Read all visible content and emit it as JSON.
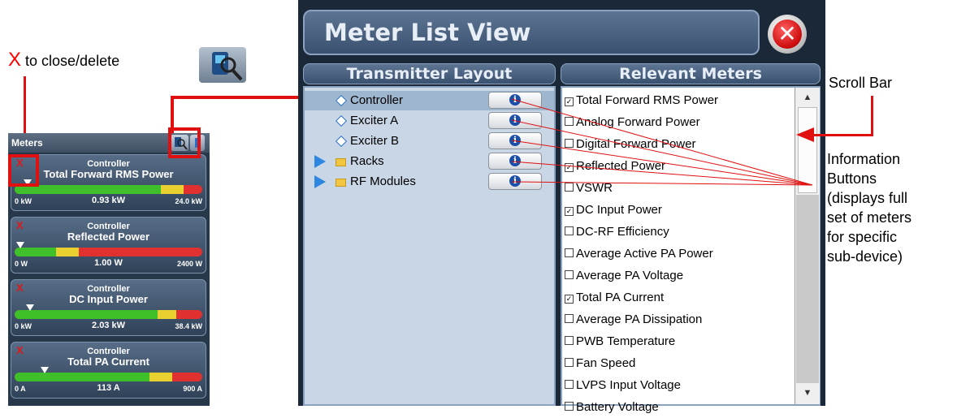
{
  "annotations": {
    "x_letter": "X",
    "close_text": " to close/delete",
    "scroll_bar": "Scroll Bar",
    "info_buttons": [
      "Information",
      "Buttons",
      "(displays full",
      "set of meters",
      "for specific",
      "sub-device)"
    ]
  },
  "meters_widget": {
    "title": "Meters",
    "cards": [
      {
        "close": "X",
        "device": "Controller",
        "name": "Total Forward RMS Power",
        "low": "0 kW",
        "value": "0.93 kW",
        "high": "24.0 kW",
        "level": 0.04
      },
      {
        "close": "X",
        "device": "Controller",
        "name": "Reflected Power",
        "low": "0 W",
        "value": "1.00 W",
        "high": "2400 W",
        "level": 0.0
      },
      {
        "close": "X",
        "device": "Controller",
        "name": "DC Input Power",
        "low": "0 kW",
        "value": "2.03 kW",
        "high": "38.4 kW",
        "level": 0.05
      },
      {
        "close": "X",
        "device": "Controller",
        "name": "Total PA Current",
        "low": "0 A",
        "value": "113 A",
        "high": "900 A",
        "level": 0.13
      }
    ]
  },
  "window": {
    "title": "Meter List View",
    "close_symbol": "✕",
    "left_header": "Transmitter Layout",
    "right_header": "Relevant Meters",
    "tree": [
      {
        "label": "Controller",
        "kind": "leaf",
        "selected": true
      },
      {
        "label": "Exciter A",
        "kind": "leaf",
        "selected": false
      },
      {
        "label": "Exciter B",
        "kind": "leaf",
        "selected": false
      },
      {
        "label": "Racks",
        "kind": "folder",
        "selected": false
      },
      {
        "label": "RF Modules",
        "kind": "folder",
        "selected": false
      }
    ],
    "info_symbol": "i",
    "meters": [
      {
        "label": "Total Forward RMS Power",
        "checked": true
      },
      {
        "label": "Analog Forward Power",
        "checked": false
      },
      {
        "label": "Digital Forward Power",
        "checked": false
      },
      {
        "label": "Reflected Power",
        "checked": true
      },
      {
        "label": "VSWR",
        "checked": false
      },
      {
        "label": "DC Input Power",
        "checked": true
      },
      {
        "label": "DC-RF Efficiency",
        "checked": false
      },
      {
        "label": "Average Active PA Power",
        "checked": false
      },
      {
        "label": "Average PA Voltage",
        "checked": false
      },
      {
        "label": "Total PA Current",
        "checked": true
      },
      {
        "label": "Average PA Dissipation",
        "checked": false
      },
      {
        "label": "PWB Temperature",
        "checked": false
      },
      {
        "label": "Fan Speed",
        "checked": false
      },
      {
        "label": "LVPS Input Voltage",
        "checked": false
      },
      {
        "label": "Battery Voltage",
        "checked": false
      }
    ],
    "scroll_up": "▲",
    "scroll_down": "▼"
  },
  "colors": {
    "annotation_red": "#e01010",
    "bar_green": "#3fbf2a",
    "bar_yellow": "#e8d030",
    "bar_red": "#e03030"
  }
}
